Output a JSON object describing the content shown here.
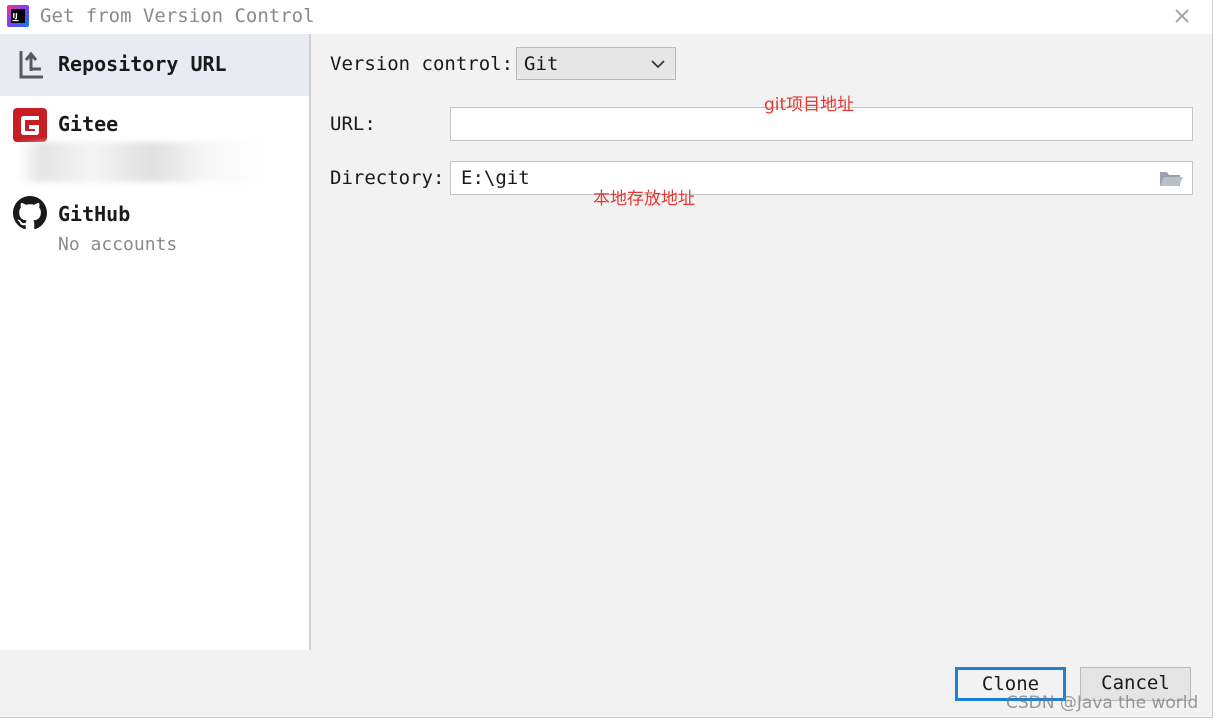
{
  "window": {
    "title": "Get from Version Control"
  },
  "sidebar": {
    "items": [
      {
        "label": "Repository URL",
        "icon": "repository-url-icon",
        "selected": true
      },
      {
        "label": "Gitee",
        "icon": "gitee-icon",
        "selected": false,
        "accent": "#c71d23"
      },
      {
        "label": "GitHub",
        "icon": "github-icon",
        "selected": false,
        "sub": "No accounts"
      }
    ]
  },
  "form": {
    "version_control_label": "Version control:",
    "version_control_value": "Git",
    "url_label": "URL:",
    "url_value": "",
    "directory_label": "Directory:",
    "directory_value": "E:\\git"
  },
  "annotations": {
    "url_note": "git项目地址",
    "directory_note": "本地存放地址",
    "color": "#e53935"
  },
  "footer": {
    "clone_label": "Clone",
    "cancel_label": "Cancel"
  },
  "watermark": "CSDN @Java the world",
  "colors": {
    "selection": "#e8ecf2",
    "focus_border": "#1e7fd6"
  }
}
